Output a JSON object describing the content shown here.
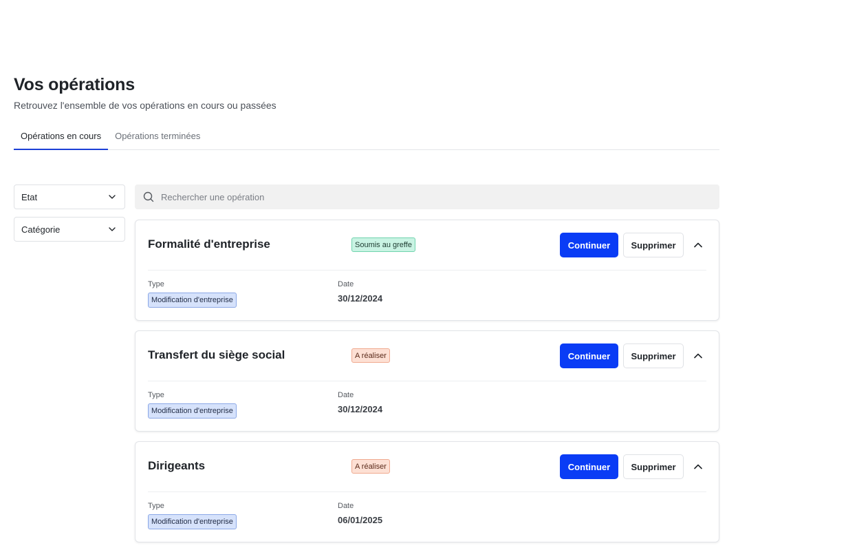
{
  "header": {
    "title": "Vos opérations",
    "subtitle": "Retrouvez l'ensemble de vos opérations en cours ou passées"
  },
  "tabs": [
    {
      "label": "Opérations en cours",
      "active": true
    },
    {
      "label": "Opérations terminées",
      "active": false
    }
  ],
  "filters": {
    "etat": "Etat",
    "categorie": "Catégorie"
  },
  "search": {
    "placeholder": "Rechercher une opération"
  },
  "labels": {
    "type": "Type",
    "date": "Date",
    "continue": "Continuer",
    "delete": "Supprimer"
  },
  "colors": {
    "accent": "#0a3cf5",
    "status_submitted": "#c9f3e3",
    "status_todo": "#fde0d4",
    "type_badge": "#d6e2fb"
  },
  "operations": [
    {
      "title": "Formalité d'entreprise",
      "status": "Soumis au greffe",
      "status_kind": "green",
      "type": "Modification d'entreprise",
      "date": "30/12/2024"
    },
    {
      "title": "Transfert du siège social",
      "status": "A réaliser",
      "status_kind": "orange",
      "type": "Modification d'entreprise",
      "date": "30/12/2024"
    },
    {
      "title": "Dirigeants",
      "status": "A réaliser",
      "status_kind": "orange",
      "type": "Modification d'entreprise",
      "date": "06/01/2025"
    }
  ]
}
